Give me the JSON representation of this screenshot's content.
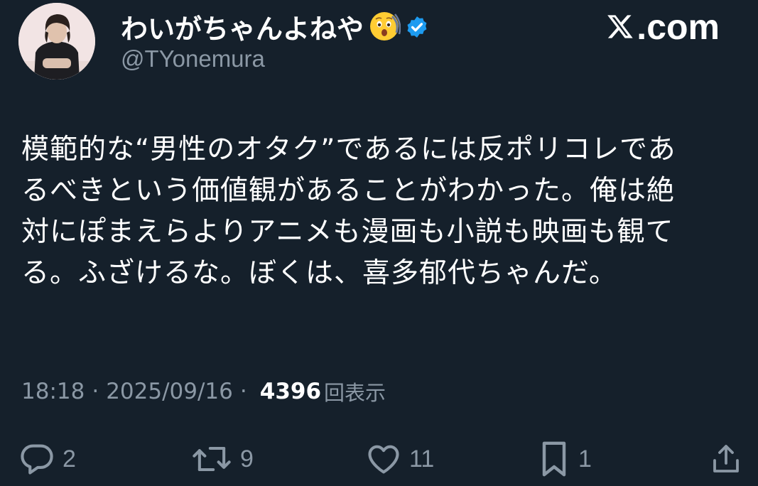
{
  "profile": {
    "display_name": "わいがちゃんよねや",
    "handle": "@TYonemura",
    "avatar_icon": "profile-photo",
    "name_emoji_icon": "astonished-face-emoji-icon",
    "verified_icon": "verified-badge-icon",
    "verified_color": "#1d9bf0"
  },
  "brand": {
    "label": ".com",
    "icon": "x-logo-icon"
  },
  "tweet": {
    "text": "模範的な“男性のオタク”であるには反ポリコレであ\nるべきという価値観があることがわかった。俺は絶\n対にぽまえらよりアニメも漫画も小説も映画も観て\nる。ふざけるな。ぼくは、喜多郁代ちゃんだ。"
  },
  "meta": {
    "time": "18:18",
    "separator": "·",
    "date": "2025/09/16",
    "views_count": "4396",
    "views_label": "回表示"
  },
  "actions": {
    "reply": {
      "icon": "reply-icon",
      "count": "2"
    },
    "repost": {
      "icon": "repost-icon",
      "count": "9"
    },
    "like": {
      "icon": "heart-icon",
      "count": "11"
    },
    "bookmark": {
      "icon": "bookmark-icon",
      "count": "1"
    },
    "share": {
      "icon": "share-icon"
    }
  },
  "colors": {
    "background": "#15202b",
    "text_primary": "#ffffff",
    "text_secondary": "#8b98a5"
  }
}
